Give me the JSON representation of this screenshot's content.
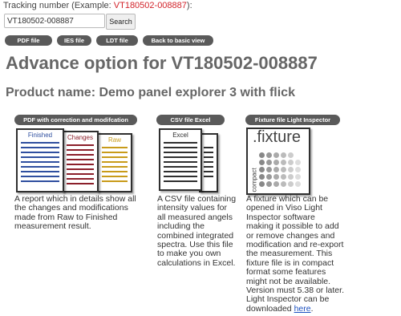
{
  "tracking": {
    "label": "Tracking number (Example: ",
    "example": "VT180502-008887",
    "suffix": "):",
    "input_value": "VT180502-008887",
    "search_label": "Search"
  },
  "toolbar": {
    "pdf_label": "PDF file",
    "ies_label": "IES file",
    "ldt_label": "LDT file",
    "back_label": "Back to basic view"
  },
  "page_title": "Advance option for VT180502-008887",
  "product_name": "Product name: Demo panel explorer 3 with flick",
  "columns": {
    "pdf": {
      "header": "PDF with correction and modifcation",
      "doc_finished": "Finished",
      "doc_changes": "Changes",
      "doc_raw": "Raw",
      "description": "A report which in details show all the changes and modifications made from Raw to Finished measurement result."
    },
    "csv": {
      "header": "CSV file Excel",
      "doc_label": "Excel",
      "description": "A CSV file containing intensity values for all measured angels including the combined integrated spectra. Use this file to make you own calculations in Excel."
    },
    "fixture": {
      "header": "Fixture file Light Inspector",
      "icon_text": ".fixture",
      "icon_subtext": "compact",
      "description": "A fixture which can be opened in Viso Light Inspector software making it possible to add or remove changes and modification and re-export the measurement. This fixture file is in compact format some features might not be available. Version must 5.38 or later. Light Inspector can be downloaded ",
      "link_text": "here",
      "description_end": "."
    }
  },
  "colors": {
    "finished": "#2f4f9f",
    "changes": "#8b1f2a",
    "raw": "#c89b1a",
    "excel": "#2f2f2f",
    "pill": "#5a5a5a",
    "example_red": "#d2232a"
  }
}
